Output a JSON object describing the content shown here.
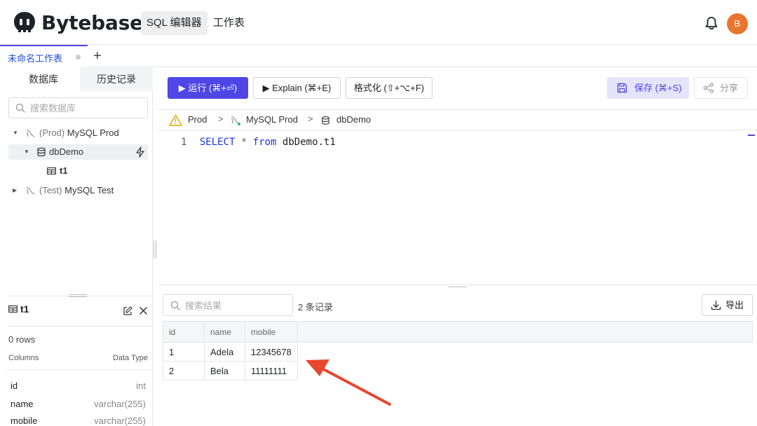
{
  "header": {
    "brand": "Bytebase",
    "nav": [
      {
        "label": "SQL 编辑器",
        "active": true
      },
      {
        "label": "工作表",
        "active": false
      }
    ],
    "avatar_initial": "B",
    "avatar_color": "#e8742f",
    "icons": {
      "notification": "bell-icon"
    }
  },
  "tabs": {
    "items": [
      {
        "label": "未命名工作表",
        "active": true
      }
    ],
    "add_label": "+"
  },
  "sidebar": {
    "tabs": [
      {
        "label": "数据库",
        "active": true
      },
      {
        "label": "历史记录",
        "active": false
      }
    ],
    "search_placeholder": "搜索数据库",
    "tree": [
      {
        "env": "(Prod)",
        "name": "MySQL Prod",
        "type": "instance",
        "expanded": true
      },
      {
        "name": "dbDemo",
        "type": "database",
        "expanded": true,
        "selected": true
      },
      {
        "name": "t1",
        "type": "table"
      },
      {
        "env": "(Test)",
        "name": "MySQL Test",
        "type": "instance",
        "expanded": false
      }
    ]
  },
  "schema_panel": {
    "table_name": "t1",
    "rows_text": "0 rows",
    "columns_header": "Columns",
    "type_header": "Data Type",
    "columns": [
      {
        "name": "id",
        "type": "int"
      },
      {
        "name": "name",
        "type": "varchar(255)"
      },
      {
        "name": "mobile",
        "type": "varchar(255)"
      }
    ]
  },
  "toolbar": {
    "run_label": "运行 (⌘+⏎)",
    "explain_label": "Explain (⌘+E)",
    "format_label": "格式化 (⇧+⌥+F)",
    "save_label": "保存 (⌘+S)",
    "share_label": "分享"
  },
  "breadcrumb": {
    "environment": "Prod",
    "instance": "MySQL Prod",
    "database": "dbDemo",
    "separator": ">"
  },
  "editor": {
    "line_number": "1",
    "tokens": {
      "kw1": "SELECT",
      "op": "*",
      "kw2": "from",
      "ident": "dbDemo.t1"
    },
    "accent_color": "#4f46e5"
  },
  "results": {
    "search_placeholder": "搜索结果",
    "count_text": "2 条记录",
    "export_label": "导出",
    "columns": [
      "id",
      "name",
      "mobile"
    ],
    "rows": [
      [
        "1",
        "Adela",
        "12345678"
      ],
      [
        "2",
        "Bela",
        "11111111"
      ]
    ]
  },
  "annotation": {
    "arrow_color": "#e8462f"
  }
}
